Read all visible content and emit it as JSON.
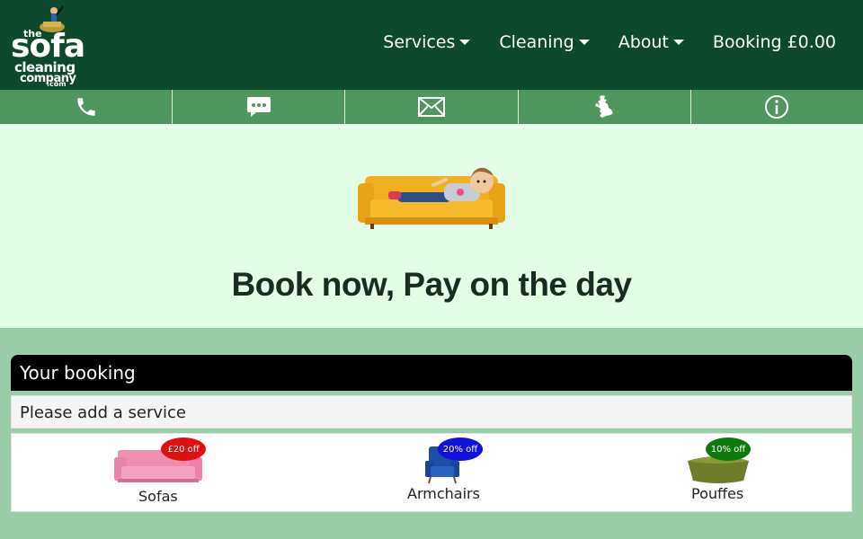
{
  "logo": {
    "the": "the",
    "sofa": "sofa",
    "cleaning": "cleaning",
    "company": "company",
    "com": ".com"
  },
  "nav": {
    "services": "Services",
    "cleaning": "Cleaning",
    "about": "About",
    "booking": "Booking £0.00"
  },
  "iconbar": [
    "phone-icon",
    "chat-icon",
    "mail-icon",
    "uk-map-icon",
    "info-icon"
  ],
  "hero": {
    "title": "Book now, Pay on the day"
  },
  "booking": {
    "heading": "Your booking",
    "message": "Please add a service"
  },
  "services": [
    {
      "label": "Sofas",
      "badge": "£20 off",
      "badge_color": "#e01010"
    },
    {
      "label": "Armchairs",
      "badge": "20% off",
      "badge_color": "#1010e0"
    },
    {
      "label": "Pouffes",
      "badge": "10% off",
      "badge_color": "#0c7a0c"
    }
  ],
  "colors": {
    "header_bg": "#0d4a2d",
    "iconbar_bg": "#4f955e",
    "hero_bg": "#e3fde6",
    "page_bg": "#99cca8"
  }
}
